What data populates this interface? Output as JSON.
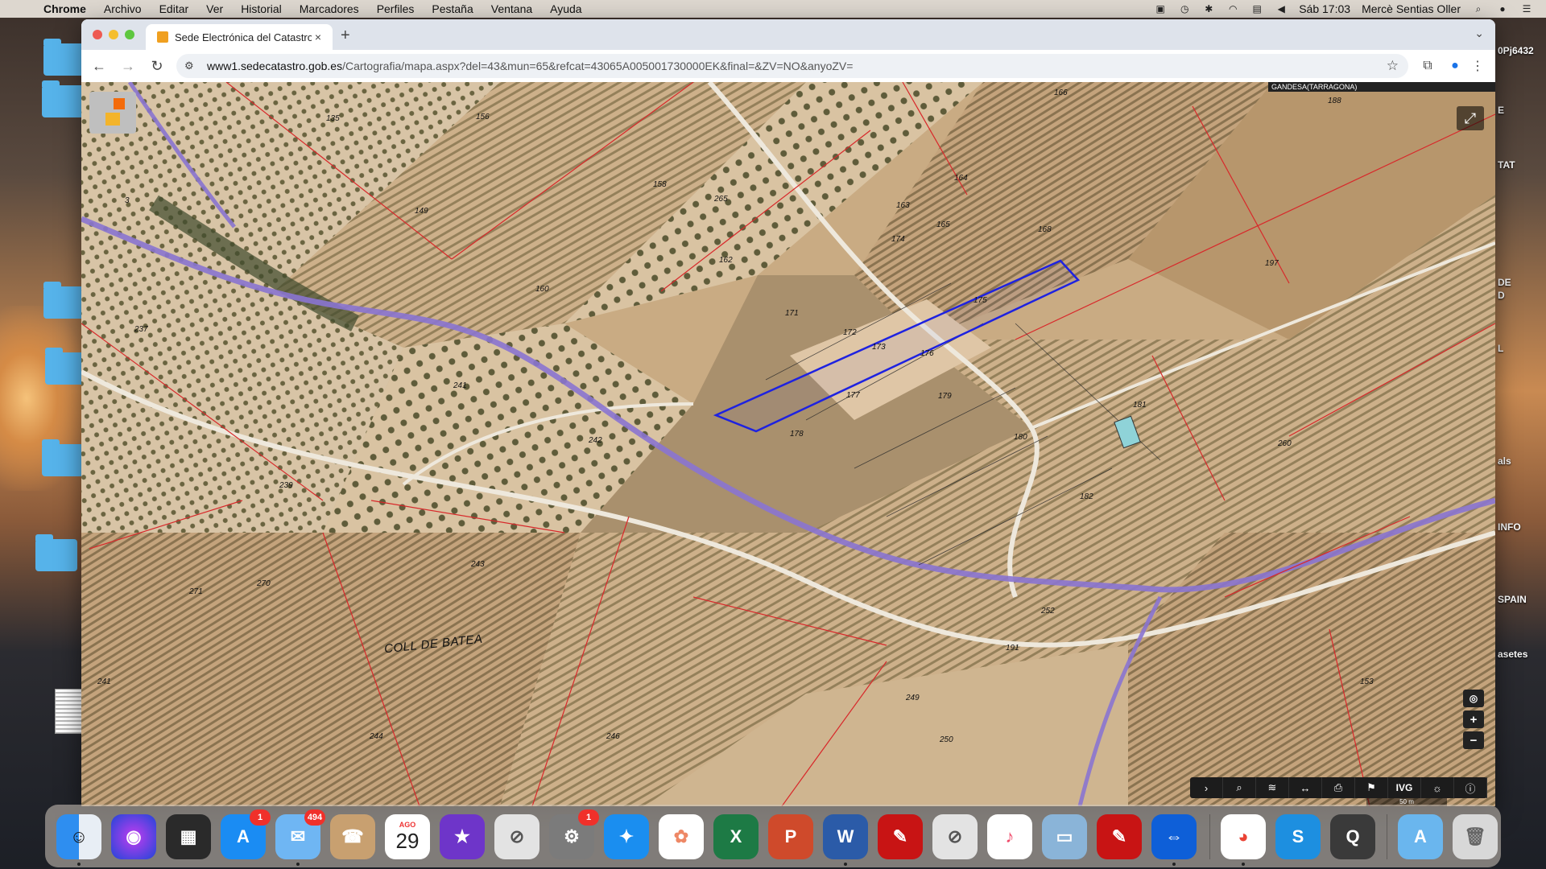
{
  "menubar": {
    "apple_icon": "apple-logo-icon",
    "items": [
      "Chrome",
      "Archivo",
      "Editar",
      "Ver",
      "Historial",
      "Marcadores",
      "Perfiles",
      "Pestaña",
      "Ventana",
      "Ayuda"
    ],
    "clock": "Sáb 17:03",
    "user": "Mercè Sentias Oller"
  },
  "desktop": {
    "right_labels": [
      "0Pj6432",
      "E",
      "TAT",
      "DE",
      "D",
      "L",
      "als",
      "INFO",
      "SPAIN",
      "asetes"
    ]
  },
  "browser": {
    "tab": {
      "title": "Sede Electrónica del Catastro",
      "close": "×"
    },
    "new_tab": "+",
    "url_host": "www1.sedecatastro.gob.es",
    "url_path": "/Cartografia/mapa.aspx?del=43&mun=65&refcat=43065A005001730000EK&final=&ZV=NO&anyoZV="
  },
  "map": {
    "municipality": "GANDESA(TARRAGONA)",
    "place_name": "COLL DE BATEA",
    "scale_text": "50 m",
    "parcel_labels": [
      {
        "n": "135"
      },
      {
        "n": "156"
      },
      {
        "n": "158"
      },
      {
        "n": "149"
      },
      {
        "n": "265"
      },
      {
        "n": "163"
      },
      {
        "n": "164"
      },
      {
        "n": "165"
      },
      {
        "n": "166"
      },
      {
        "n": "168"
      },
      {
        "n": "162"
      },
      {
        "n": "160"
      },
      {
        "n": "171"
      },
      {
        "n": "172"
      },
      {
        "n": "173"
      },
      {
        "n": "174"
      },
      {
        "n": "176"
      },
      {
        "n": "175"
      },
      {
        "n": "177"
      },
      {
        "n": "178"
      },
      {
        "n": "179"
      },
      {
        "n": "180"
      },
      {
        "n": "181"
      },
      {
        "n": "182"
      },
      {
        "n": "197"
      },
      {
        "n": "260"
      },
      {
        "n": "237"
      },
      {
        "n": "241"
      },
      {
        "n": "242"
      },
      {
        "n": "271"
      },
      {
        "n": "270"
      },
      {
        "n": "243"
      },
      {
        "n": "252"
      },
      {
        "n": "249"
      },
      {
        "n": "250"
      },
      {
        "n": "246"
      },
      {
        "n": "244"
      },
      {
        "n": "153"
      },
      {
        "n": "191"
      },
      {
        "n": "188"
      },
      {
        "n": "3"
      },
      {
        "n": "239"
      },
      {
        "n": "241"
      }
    ],
    "tools": [
      "chevron-right-icon",
      "search-icon",
      "layers-icon",
      "measure-icon",
      "print-icon",
      "street-icon",
      "IVG",
      "sun-icon",
      "info-icon"
    ],
    "tool_text_ivg": "IVG",
    "zoom_in": "+",
    "zoom_out": "−",
    "locate": "◎"
  },
  "dock": {
    "apps": [
      {
        "name": "finder",
        "badge": ""
      },
      {
        "name": "siri",
        "badge": ""
      },
      {
        "name": "photo-booth",
        "badge": ""
      },
      {
        "name": "app-store",
        "badge": "1"
      },
      {
        "name": "mail",
        "badge": "494"
      },
      {
        "name": "contacts",
        "badge": ""
      },
      {
        "name": "calendar",
        "badge": "",
        "month": "AGO",
        "day": "29"
      },
      {
        "name": "imovie",
        "badge": ""
      },
      {
        "name": "blocked-app",
        "badge": ""
      },
      {
        "name": "system-preferences",
        "badge": "1"
      },
      {
        "name": "safari",
        "badge": ""
      },
      {
        "name": "photos",
        "badge": ""
      },
      {
        "name": "excel",
        "badge": ""
      },
      {
        "name": "powerpoint",
        "badge": ""
      },
      {
        "name": "word",
        "badge": ""
      },
      {
        "name": "acrobat",
        "badge": ""
      },
      {
        "name": "blocked-app-2",
        "badge": ""
      },
      {
        "name": "music",
        "badge": ""
      },
      {
        "name": "preview",
        "badge": ""
      },
      {
        "name": "acrobat-reader",
        "badge": ""
      },
      {
        "name": "teamviewer",
        "badge": ""
      },
      {
        "name": "chrome",
        "badge": ""
      },
      {
        "name": "skype",
        "badge": ""
      },
      {
        "name": "quicktime",
        "badge": ""
      },
      {
        "name": "applications-folder",
        "badge": ""
      },
      {
        "name": "trash",
        "badge": ""
      }
    ]
  }
}
